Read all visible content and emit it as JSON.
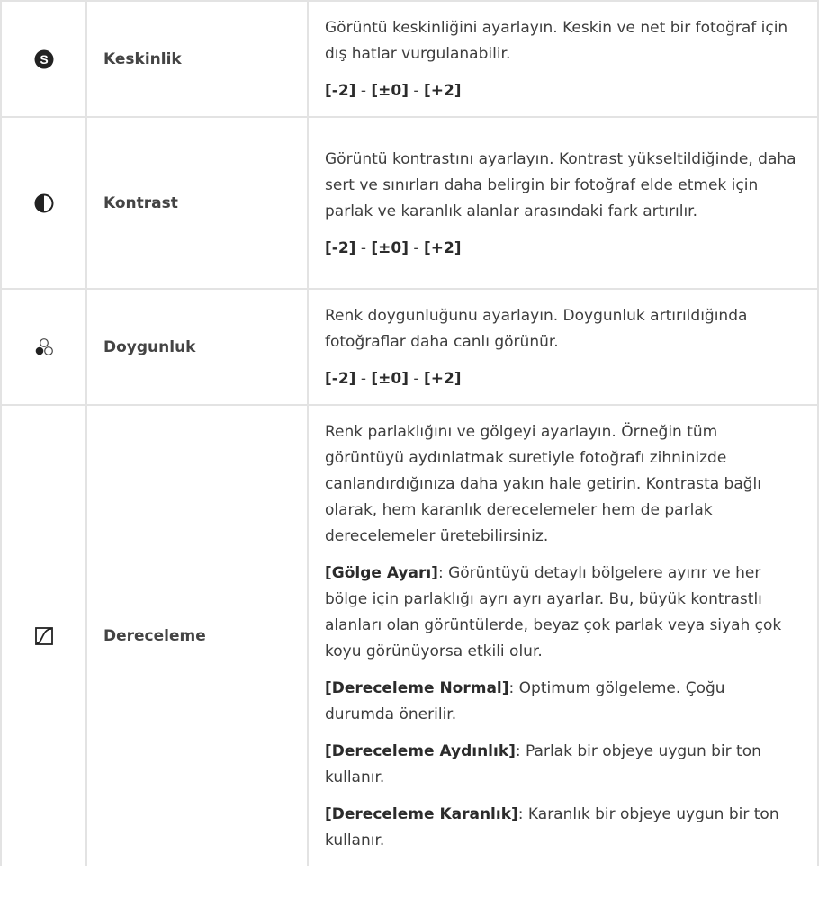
{
  "rows": [
    {
      "icon": "sharpness-icon",
      "name": "Keskinlik",
      "description": "Görüntü keskinliğini ayarlayın. Keskin ve net bir fotoğraf için dış hatlar vurgulanabilir.",
      "range": {
        "min": "[-2]",
        "mid": "[±0]",
        "max": "[+2]",
        "sep": " - "
      }
    },
    {
      "icon": "contrast-icon",
      "name": "Kontrast",
      "description": "Görüntü kontrastını ayarlayın. Kontrast yükseltildiğinde, daha sert ve sınırları daha belirgin bir fotoğraf elde etmek için parlak ve karanlık alanlar arasındaki fark artırılır.",
      "range": {
        "min": "[-2]",
        "mid": "[±0]",
        "max": "[+2]",
        "sep": " - "
      }
    },
    {
      "icon": "saturation-icon",
      "name": "Doygunluk",
      "description": "Renk doygunluğunu ayarlayın. Doygunluk artırıldığında fotoğraflar daha canlı görünür.",
      "range": {
        "min": "[-2]",
        "mid": "[±0]",
        "max": "[+2]",
        "sep": " - "
      }
    },
    {
      "icon": "gradation-icon",
      "name": "Dereceleme",
      "intro": "Renk parlaklığını ve gölgeyi ayarlayın. Örneğin tüm görüntüyü aydınlatmak suretiyle fotoğrafı zihninizde canlandırdığınıza daha yakın hale getirin. Kontrasta bağlı olarak, hem karanlık derecelemeler hem de parlak derecelemeler üretebilirsiniz.",
      "options": [
        {
          "label": "[Gölge Ayarı]",
          "text": ": Görüntüyü detaylı bölgelere ayırır ve her bölge için parlaklığı ayrı ayrı ayarlar. Bu, büyük kontrastlı alanları olan görüntülerde, beyaz çok parlak veya siyah çok koyu görünüyorsa etkili olur."
        },
        {
          "label": "[Dereceleme Normal]",
          "text": ": Optimum gölgeleme. Çoğu durumda önerilir."
        },
        {
          "label": "[Dereceleme Aydınlık]",
          "text": ": Parlak bir objeye uygun bir ton kullanır."
        },
        {
          "label": "[Dereceleme Karanlık]",
          "text": ": Karanlık bir objeye uygun bir ton kullanır."
        }
      ]
    }
  ]
}
